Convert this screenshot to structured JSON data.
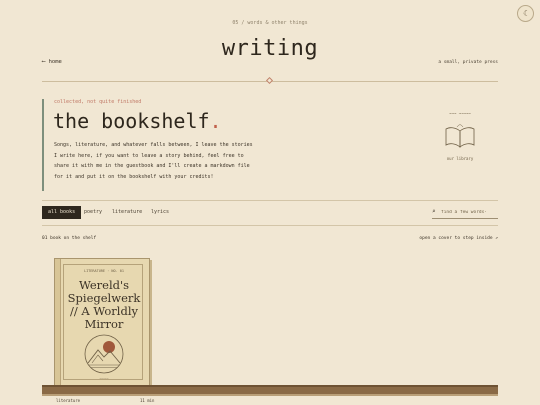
{
  "header": {
    "kicker": "05 / words & other things",
    "title": "writing",
    "home_link": "⟵ home",
    "note": "a small, private press",
    "theme_toggle_icon": "☾"
  },
  "intro": {
    "kicker": "collected, not quite finished",
    "title": "the bookshelf",
    "title_dot": ".",
    "body": "Songs, literature, and whatever falls between, I leave the stories I write here, if you want to leave a story behind, feel free to share it with me in the guestbook and I'll create a markdown file for it and put it on the bookshelf with your credits!",
    "badge_top": "~~~ ~~~~~",
    "badge_bottom": "our library",
    "badge_icon": "open-book-icon"
  },
  "filters": [
    {
      "label": "all books",
      "active": true
    },
    {
      "label": "poetry",
      "active": false
    },
    {
      "label": "literature",
      "active": false
    },
    {
      "label": "lyrics",
      "active": false
    }
  ],
  "search": {
    "placeholder": "find a few words·",
    "icon": "search-icon"
  },
  "shelf": {
    "count_text": "01 book on the shelf",
    "hint_text": "open a cover to step inside ↗",
    "label_left": "literature",
    "label_right": "11 min"
  },
  "books": [
    {
      "series": "LITERATURE · NO. 01",
      "title": "Wereld's Spiegelwerk // A Worldly Mirror",
      "footer": "~~~~~",
      "cover_color": "#e7d8b0",
      "sun_color": "#a0583b"
    }
  ],
  "colors": {
    "background": "#f1e7d3",
    "accent": "#c0604a",
    "ink": "#2e271d",
    "shelf_wood": "#8a6a46"
  }
}
